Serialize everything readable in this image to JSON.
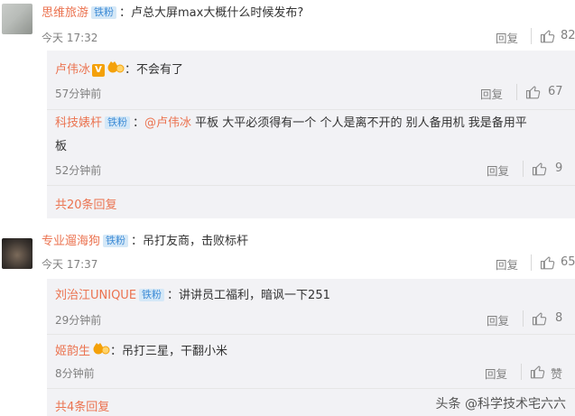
{
  "comments": [
    {
      "user": "思维旅游",
      "badge": "铁粉",
      "text": "：卢总大屏max大概什么时候发布?",
      "time": "今天 17:32",
      "reply_label": "回复",
      "likes": "82",
      "replies": [
        {
          "user": "卢伟冰",
          "vip": "V",
          "text": "：不会有了",
          "time": "57分钟前",
          "reply_label": "回复",
          "likes": "67"
        },
        {
          "user": "科技婊杆",
          "badge": "铁粉",
          "mention": "@卢伟冰",
          "text_line1": " 平板 大平必须得有一个  个人是离不开的  别人备用机  我是备用平",
          "text_line2": "板",
          "time": "52分钟前",
          "reply_label": "回复",
          "likes": "9"
        }
      ],
      "more_replies": "共20条回复"
    },
    {
      "user": "专业遛海狗",
      "badge": "铁粉",
      "text": "：吊打友商，击败标杆",
      "time": "今天 17:37",
      "reply_label": "回复",
      "likes": "65",
      "replies": [
        {
          "user": "刘治江UNIQUE",
          "badge": "铁粉",
          "text": "：讲讲员工福利，暗讽一下251",
          "time": "29分钟前",
          "reply_label": "回复",
          "likes": "8"
        },
        {
          "user": "姬韵生",
          "text": "：吊打三星，干翻小米",
          "time": "8分钟前",
          "reply_label": "回复",
          "likes": "赞"
        }
      ],
      "more_replies": "共4条回复"
    }
  ],
  "watermark": "头条 @科学技术宅六六",
  "colors": {
    "username": "#eb7350",
    "badge_bg": "#d5e8f7",
    "badge_text": "#3d8bd6",
    "subblock_bg": "#f2f2f5"
  },
  "icons": {
    "like": "thumbs-up-icon",
    "vip": "vip-v-icon",
    "fan": "fan-crown-icon"
  }
}
